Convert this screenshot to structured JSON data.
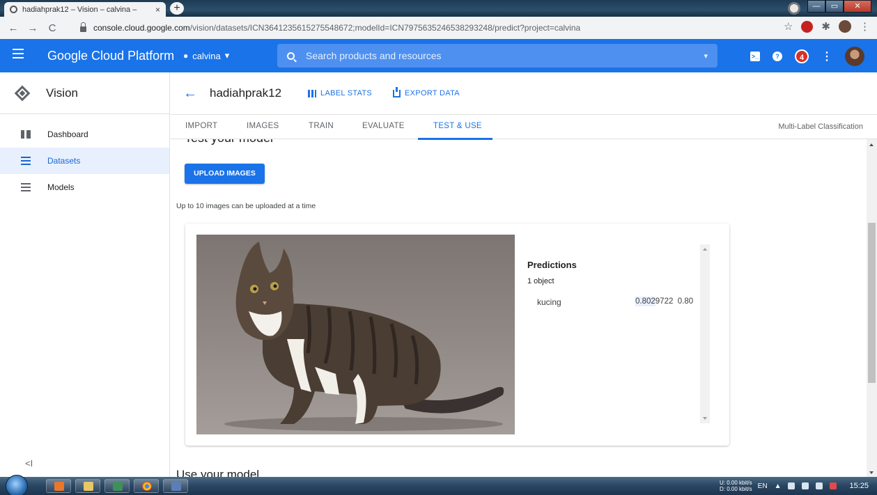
{
  "browser": {
    "tab_title": "hadiahprak12 – Vision – calvina –",
    "tab_close": "×",
    "newtab": "+",
    "url_host": "console.cloud.google.com",
    "url_path": "/vision/datasets/ICN3641235615275548672;modelId=ICN7975635246538293248/predict?project=calvina",
    "win_min": "—",
    "win_max": "▭",
    "win_close": "✕",
    "nav_back": "←",
    "nav_fwd": "→",
    "nav_reload": "C",
    "star": "☆",
    "puzzle": "✱",
    "menu": "⋮",
    "ext_red_label": "",
    "profile": ""
  },
  "header": {
    "title": "Google Cloud Platform",
    "project": "calvina",
    "project_caret": "▾",
    "search_placeholder": "Search products and resources",
    "search_caret": "▾",
    "terminal": ">_",
    "help": "?",
    "notifications": "4",
    "more": "⋮"
  },
  "sidebar": {
    "product": "Vision",
    "items": [
      {
        "label": "Dashboard",
        "icon": "dashboard-icon"
      },
      {
        "label": "Datasets",
        "icon": "list-icon",
        "active": true
      },
      {
        "label": "Models",
        "icon": "list-icon"
      }
    ],
    "collapse": "<I"
  },
  "dataset": {
    "back": "←",
    "name": "hadiahprak12",
    "label_stats": "LABEL STATS",
    "export_data": "EXPORT DATA"
  },
  "tabs": [
    {
      "label": "IMPORT"
    },
    {
      "label": "IMAGES"
    },
    {
      "label": "TRAIN"
    },
    {
      "label": "EVALUATE"
    },
    {
      "label": "TEST & USE",
      "active": true
    }
  ],
  "model_type": "Multi-Label Classification",
  "test": {
    "heading": "Test your model",
    "upload_button": "UPLOAD IMAGES",
    "hint": "Up to 10 images can be uploaded at a time"
  },
  "predictions": {
    "title": "Predictions",
    "count": "1 object",
    "items": [
      {
        "label": "kucing",
        "score_highlight": "0.802",
        "score_rest": "9722",
        "rounded": "0.80"
      }
    ]
  },
  "use": {
    "heading": "Use your model"
  },
  "taskbar": {
    "net_up": "U:   0.00 kbit/s",
    "net_down": "D:   0.00 kbit/s",
    "lang": "EN",
    "tray_up": "▲",
    "clock": "15:25"
  }
}
